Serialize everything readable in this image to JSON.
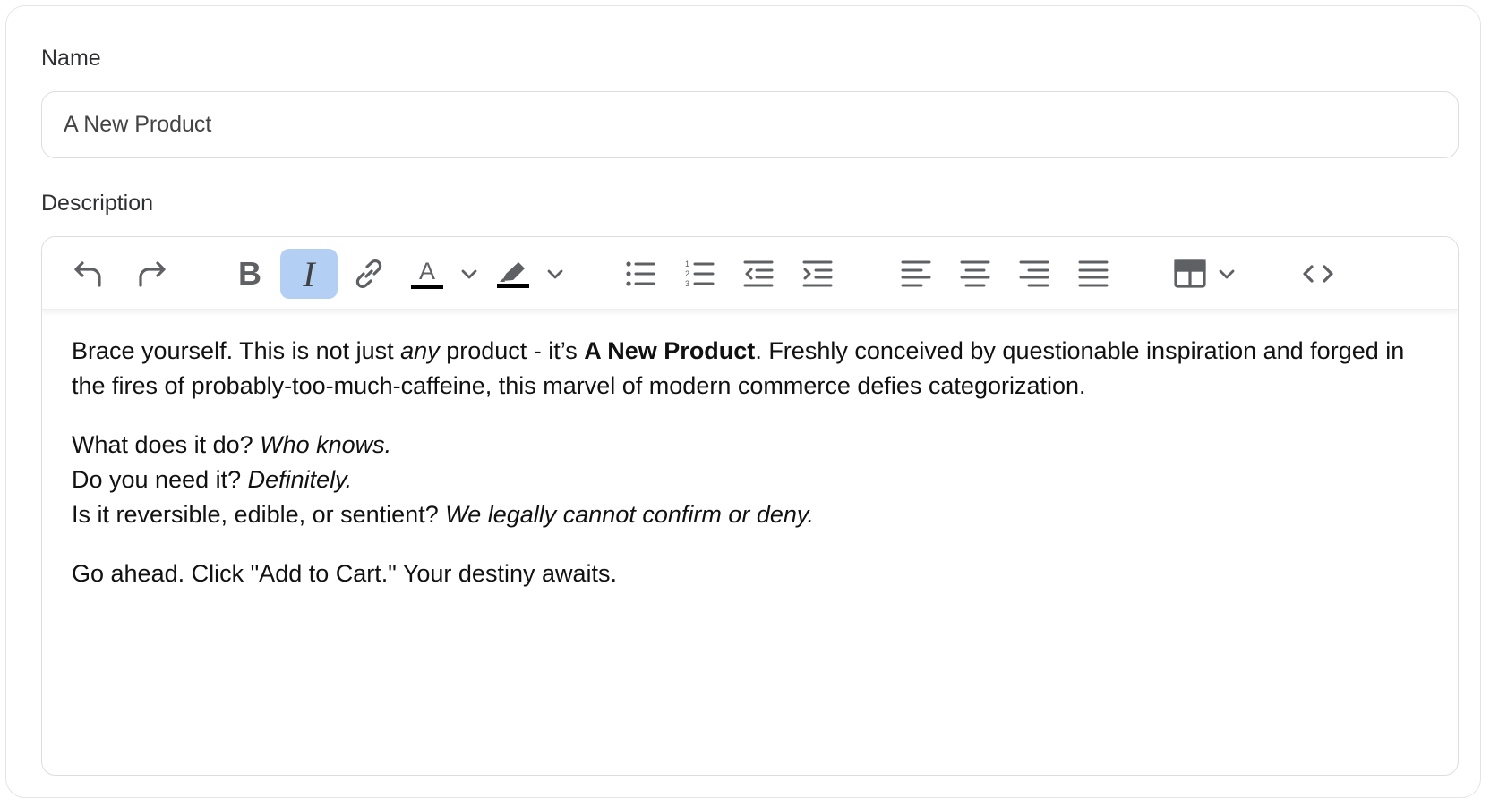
{
  "form": {
    "name_label": "Name",
    "name_value": "A New Product",
    "description_label": "Description"
  },
  "toolbar": {
    "buttons": [
      {
        "id": "undo",
        "icon": "undo-icon"
      },
      {
        "id": "redo",
        "icon": "redo-icon"
      },
      {
        "id": "bold",
        "icon": "bold-icon",
        "text": "B"
      },
      {
        "id": "italic",
        "icon": "italic-icon",
        "text": "I",
        "active": true
      },
      {
        "id": "link",
        "icon": "link-icon"
      },
      {
        "id": "text-color",
        "icon": "text-color-icon",
        "text": "A"
      },
      {
        "id": "text-color-dropdown",
        "icon": "chevron-down-icon"
      },
      {
        "id": "highlight",
        "icon": "highlighter-icon"
      },
      {
        "id": "highlight-dropdown",
        "icon": "chevron-down-icon"
      },
      {
        "id": "bullet-list",
        "icon": "bullet-list-icon"
      },
      {
        "id": "numbered-list",
        "icon": "numbered-list-icon",
        "numbers": [
          "1",
          "2",
          "3"
        ]
      },
      {
        "id": "outdent",
        "icon": "outdent-icon"
      },
      {
        "id": "indent",
        "icon": "indent-icon"
      },
      {
        "id": "align-left",
        "icon": "align-left-icon"
      },
      {
        "id": "align-center",
        "icon": "align-center-icon"
      },
      {
        "id": "align-right",
        "icon": "align-right-icon"
      },
      {
        "id": "align-justify",
        "icon": "align-justify-icon"
      },
      {
        "id": "table",
        "icon": "table-icon"
      },
      {
        "id": "table-dropdown",
        "icon": "chevron-down-icon"
      },
      {
        "id": "source-code",
        "icon": "code-icon"
      }
    ],
    "active_color": "#b4cff4",
    "icon_color": "#5f6064"
  },
  "content": {
    "p1": {
      "a": "Brace yourself. This is not just ",
      "b_italic": "any",
      "c": " product - it’s ",
      "d_bold": "A New Product",
      "e": ". Freshly conceived by questionable inspiration and forged in the fires of probably-too-much-caffeine, this marvel of modern commerce defies categorization."
    },
    "p2": {
      "l1": "What does it do? ",
      "l1_italic": "Who knows.",
      "l2": "Do you need it? ",
      "l2_italic": "Definitely.",
      "l3": "Is it reversible, edible, or sentient? ",
      "l3_italic": "We legally cannot confirm or deny."
    },
    "p3": "Go ahead. Click \"Add to Cart.\" Your destiny awaits."
  }
}
